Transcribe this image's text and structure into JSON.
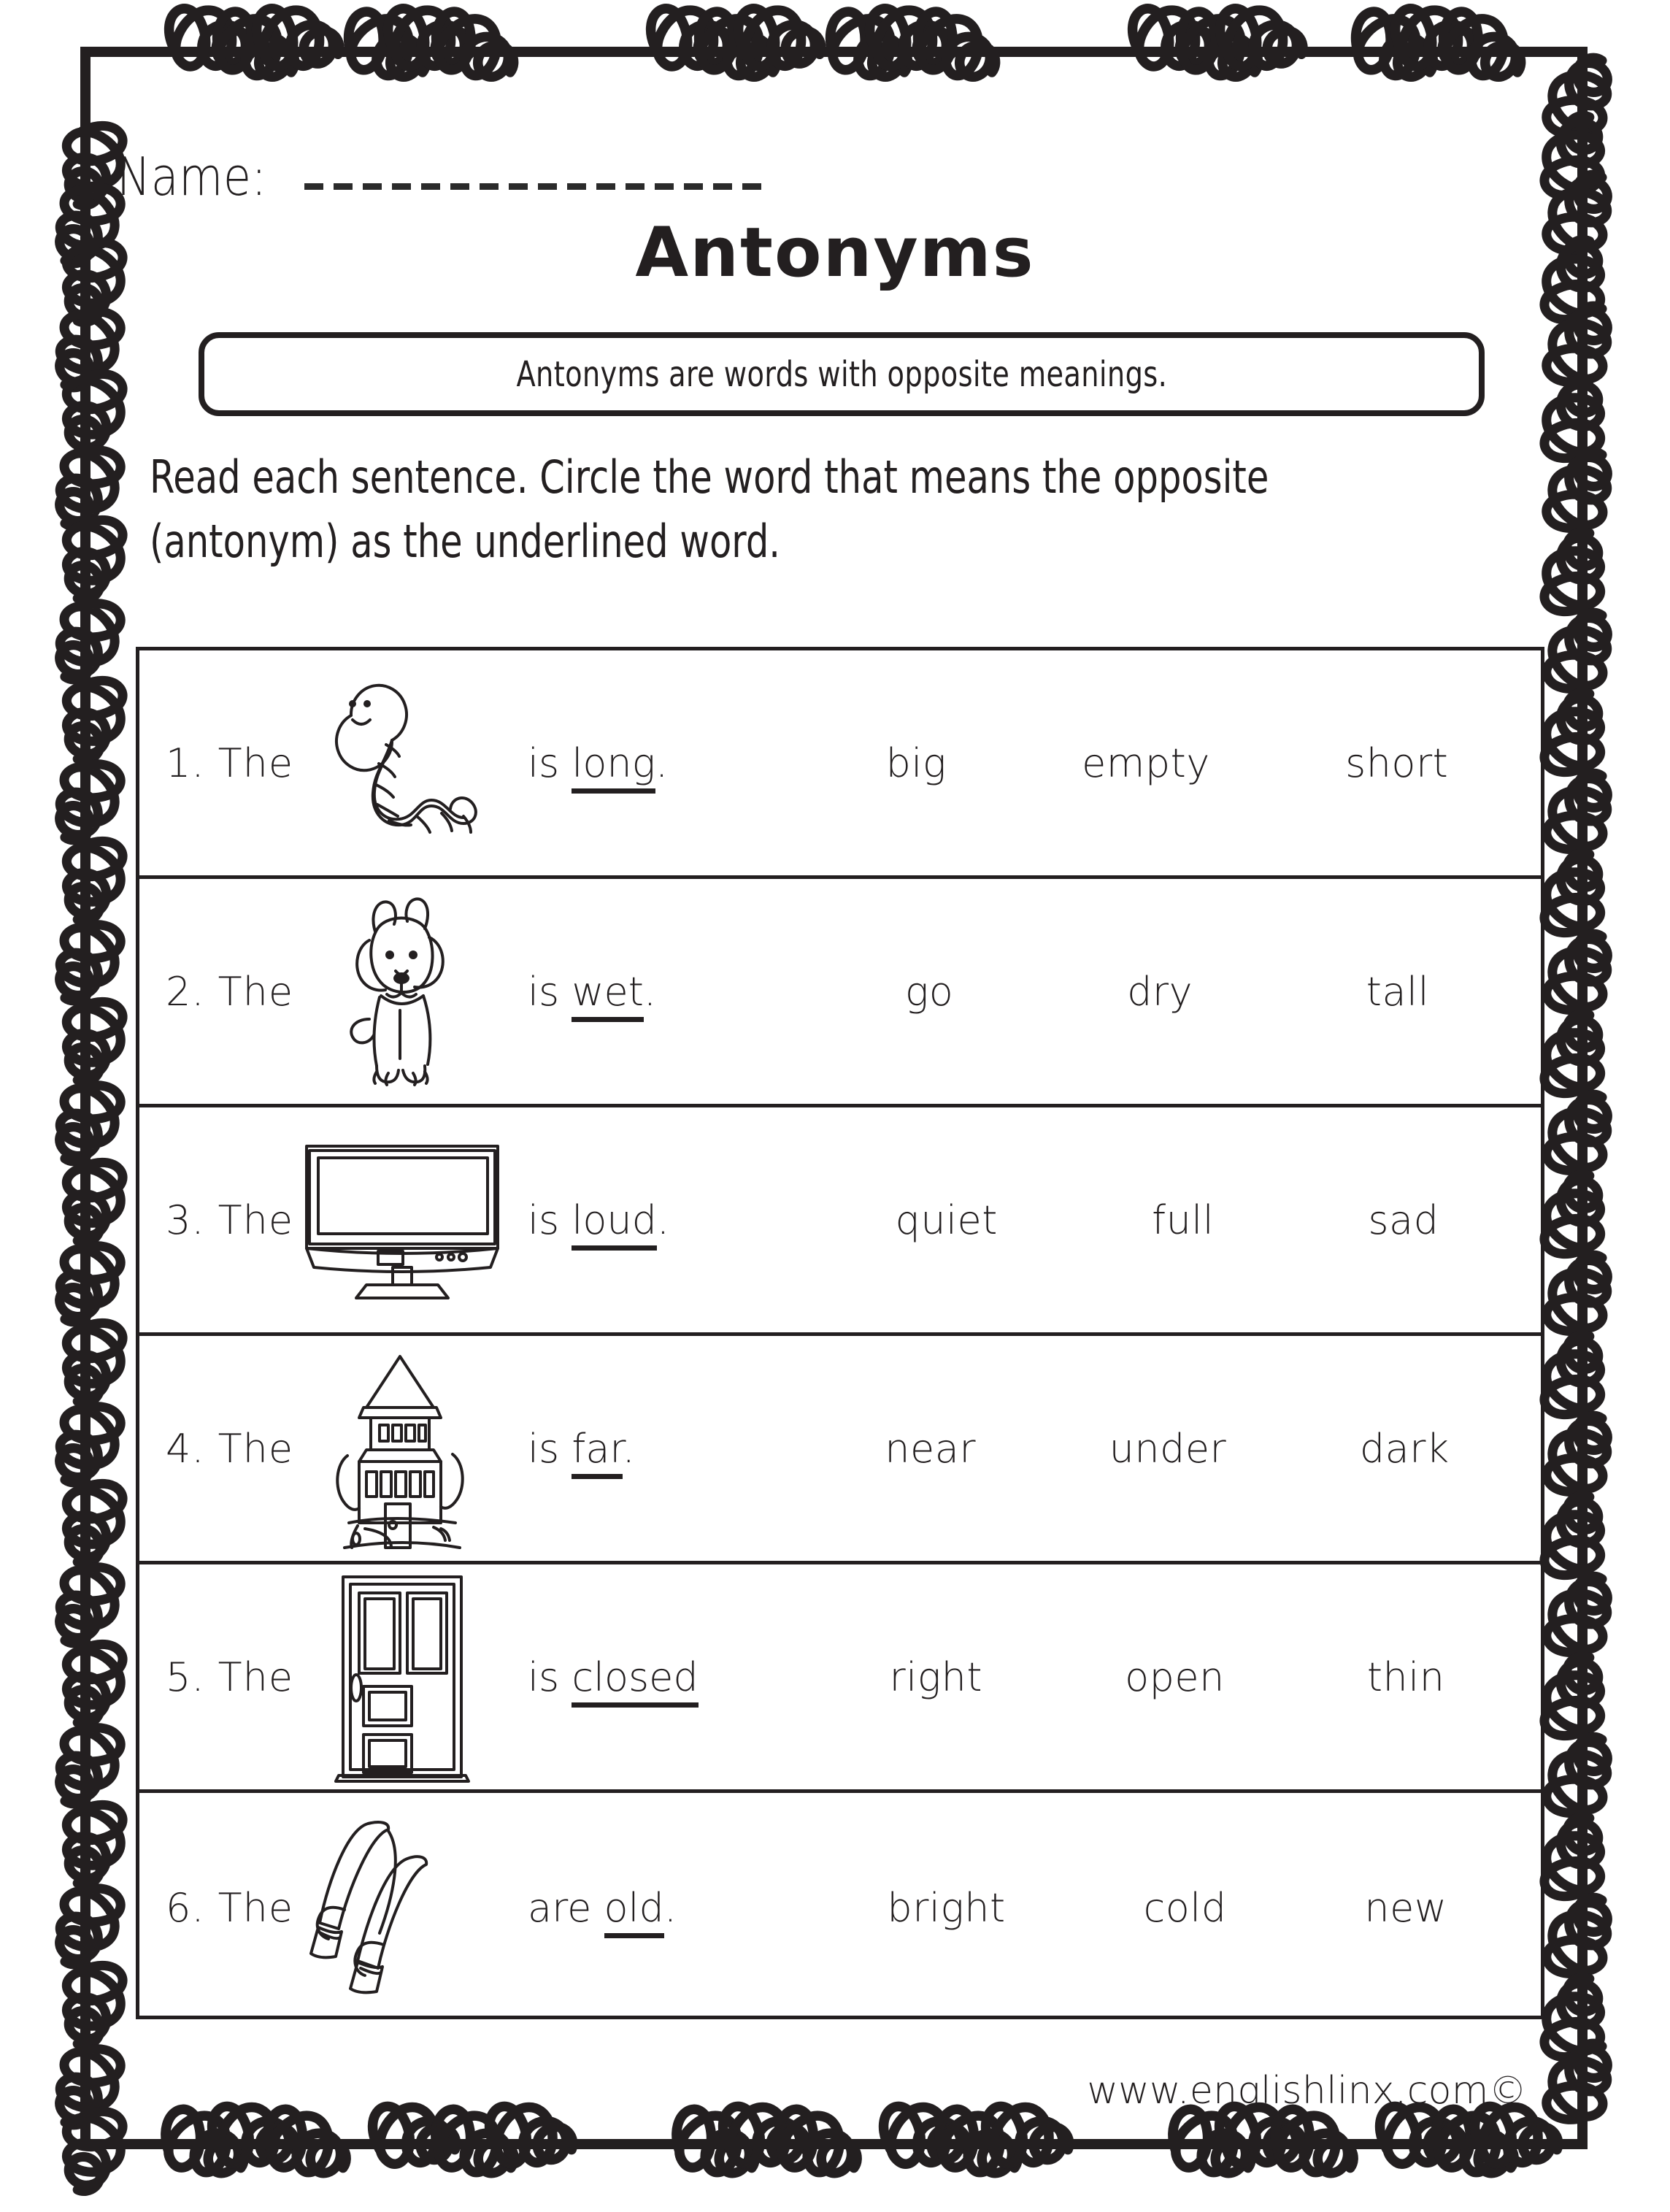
{
  "page": {
    "name_label": "Name:",
    "name_blank_value": "",
    "title": "Antonyms",
    "definition": "Antonyms are words with opposite meanings.",
    "instructions_line1": "Read each sentence. Circle the word that means the opposite",
    "instructions_line2": "(antonym) as the underlined word.",
    "footer": "www.englishlinx.com©",
    "ink_color": "#231f20",
    "paper_color": "#ffffff"
  },
  "questions": [
    {
      "number": "1. The",
      "picture": "worm-icon",
      "phrase_prefix": "is ",
      "phrase_underlined": "long",
      "phrase_suffix": ".",
      "options": [
        "big",
        "empty",
        "short"
      ]
    },
    {
      "number": "2. The",
      "picture": "dog-icon",
      "phrase_prefix": "is ",
      "phrase_underlined": "wet",
      "phrase_suffix": ".",
      "options": [
        "go",
        "dry",
        "tall"
      ]
    },
    {
      "number": "3. The",
      "picture": "television-icon",
      "phrase_prefix": "is ",
      "phrase_underlined": "loud",
      "phrase_suffix": ".",
      "options": [
        "quiet",
        "full",
        "sad"
      ]
    },
    {
      "number": "4. The",
      "picture": "building-icon",
      "phrase_prefix": "is ",
      "phrase_underlined": "far",
      "phrase_suffix": ".",
      "options": [
        "near",
        "under",
        "dark"
      ]
    },
    {
      "number": "5. The",
      "picture": "door-icon",
      "phrase_prefix": "is ",
      "phrase_underlined": "closed",
      "phrase_suffix": "",
      "options": [
        "right",
        "open",
        "thin"
      ]
    },
    {
      "number": "6. The",
      "picture": "mittens-icon",
      "phrase_prefix": "are ",
      "phrase_underlined": "old",
      "phrase_suffix": ".",
      "options": [
        "bright",
        "cold",
        "new"
      ]
    }
  ]
}
